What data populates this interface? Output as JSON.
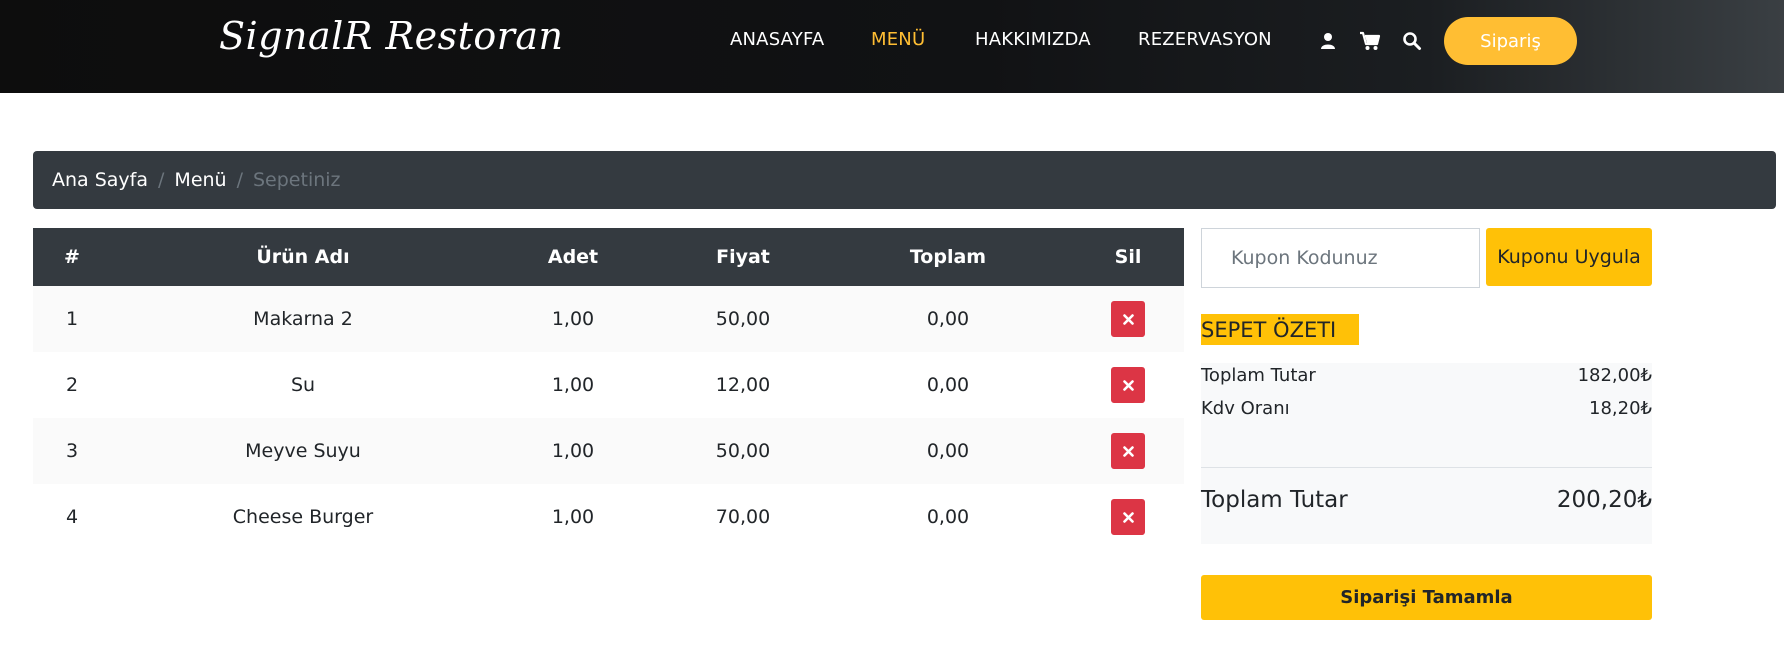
{
  "header": {
    "brand": "SignalR Restoran",
    "nav": [
      {
        "label": "ANASAYFA",
        "active": false
      },
      {
        "label": "MENÜ",
        "active": true
      },
      {
        "label": "HAKKIMIZDA",
        "active": false
      },
      {
        "label": "REZERVASYON",
        "active": false
      }
    ],
    "icons": [
      "user-icon",
      "cart-icon",
      "search-icon"
    ],
    "order_button": "Sipariş"
  },
  "breadcrumb": {
    "items": [
      "Ana Sayfa",
      "Menü"
    ],
    "current": "Sepetiniz",
    "separator": "/"
  },
  "cart_table": {
    "columns": [
      "#",
      "Ürün Adı",
      "Adet",
      "Fiyat",
      "Toplam",
      "Sil"
    ],
    "rows": [
      {
        "no": "1",
        "name": "Makarna 2",
        "qty": "1,00",
        "price": "50,00",
        "total": "0,00"
      },
      {
        "no": "2",
        "name": "Su",
        "qty": "1,00",
        "price": "12,00",
        "total": "0,00"
      },
      {
        "no": "3",
        "name": "Meyve Suyu",
        "qty": "1,00",
        "price": "50,00",
        "total": "0,00"
      },
      {
        "no": "4",
        "name": "Cheese Burger",
        "qty": "1,00",
        "price": "70,00",
        "total": "0,00"
      }
    ],
    "delete_icon": "close-icon"
  },
  "coupon": {
    "placeholder": "Kupon Kodunuz",
    "button": "Kuponu Uygula"
  },
  "summary": {
    "title": "SEPET ÖZETI",
    "subtotal_label": "Toplam Tutar",
    "subtotal_value": "182,00₺",
    "tax_label": "Kdv Oranı",
    "tax_value": "18,20₺",
    "total_label": "Toplam Tutar",
    "total_value": "200,20₺"
  },
  "complete_button": "Siparişi Tamamla",
  "colors": {
    "accent": "#ffbe33",
    "warning": "#ffc107",
    "danger": "#dc3545",
    "dark": "#343a40"
  }
}
